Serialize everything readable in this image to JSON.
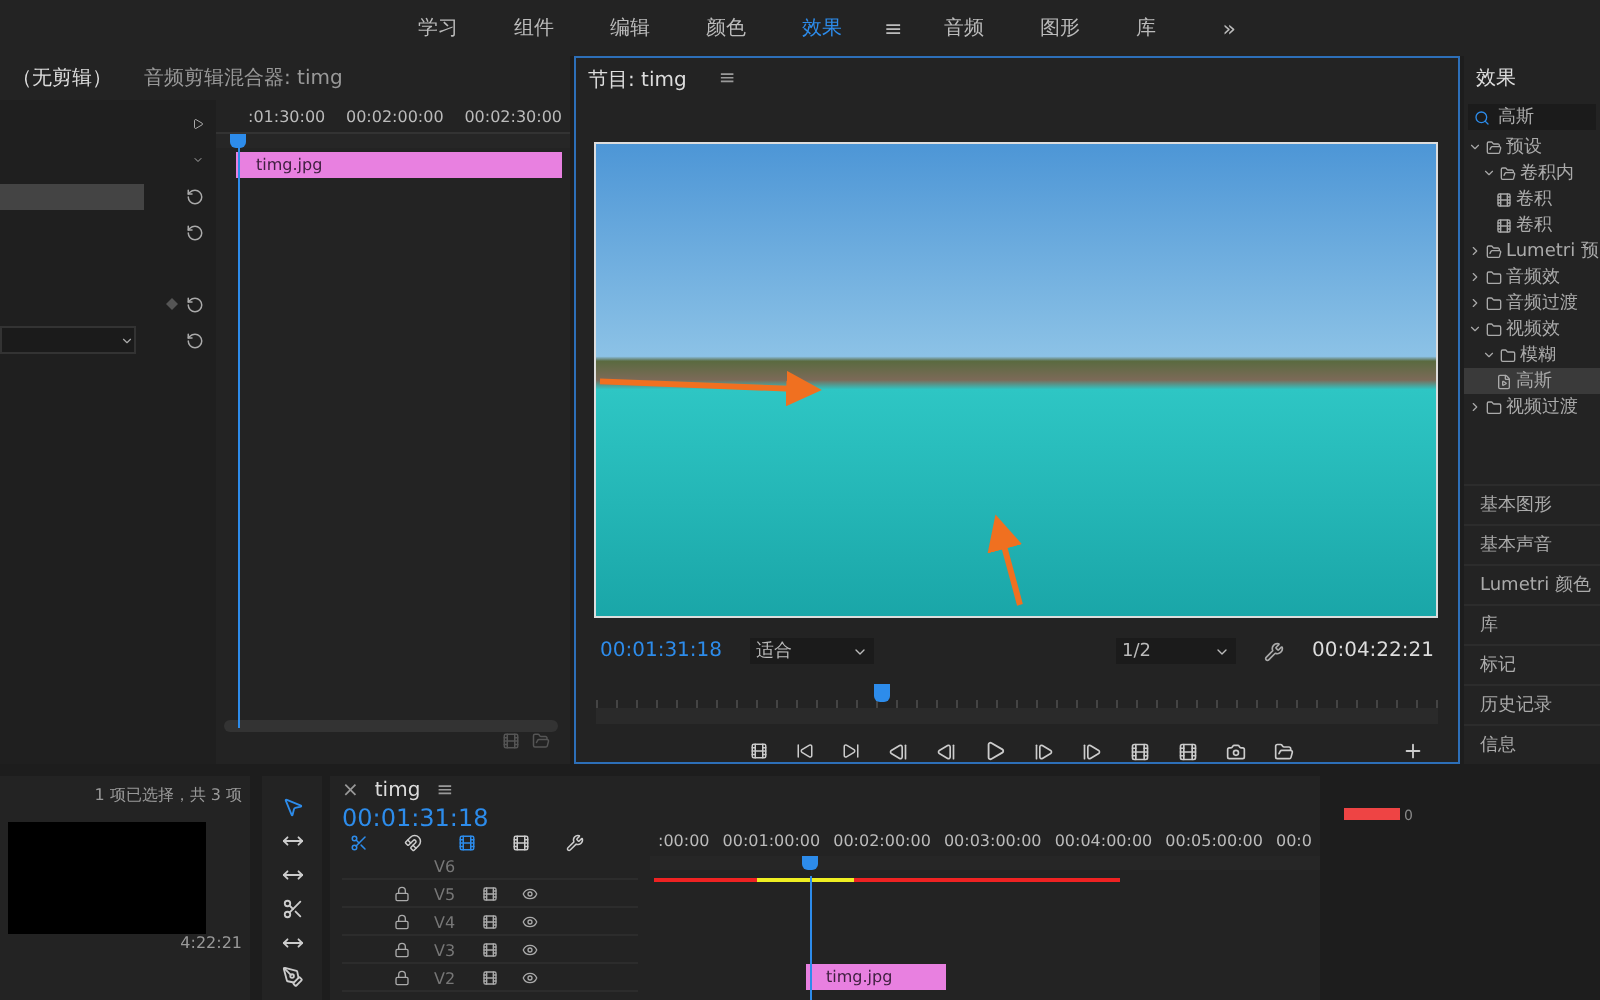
{
  "workspace_tabs": [
    {
      "label": "学习",
      "selected": false
    },
    {
      "label": "组件",
      "selected": false
    },
    {
      "label": "编辑",
      "selected": false
    },
    {
      "label": "颜色",
      "selected": false
    },
    {
      "label": "效果",
      "selected": true
    },
    {
      "label": "音频",
      "selected": false
    },
    {
      "label": "图形",
      "selected": false
    },
    {
      "label": "库",
      "selected": false
    }
  ],
  "workspace_menu": "≡",
  "more": "»",
  "source_panel": {
    "tabs": [
      "（无剪辑）",
      "音频剪辑混合器: timg"
    ],
    "ruler": [
      ":01:30:00",
      "00:02:00:00",
      "00:02:30:00"
    ],
    "clip": "timg.jpg",
    "playhead": {
      "level": 0.06
    }
  },
  "program": {
    "title": "节目: timg",
    "menu": "≡",
    "timecode": "00:01:31:18",
    "zoom": "适合",
    "resolution": "1/2",
    "duration": "00:04:22:21",
    "playhead": {
      "level": 0.34
    }
  },
  "effects": {
    "title": "效果",
    "search": "高斯",
    "tree": [
      {
        "label": "预设",
        "kind": "bin",
        "expanded": true,
        "selected": false,
        "children": [
          {
            "label": "卷积内",
            "kind": "bin",
            "expanded": true,
            "selected": false,
            "children": [
              {
                "label": "卷积",
                "kind": "preset",
                "selected": false
              },
              {
                "label": "卷积",
                "kind": "preset",
                "selected": false
              }
            ]
          }
        ]
      },
      {
        "label": "Lumetri 预",
        "kind": "bin",
        "expanded": false,
        "selected": false
      },
      {
        "label": "音频效",
        "kind": "folder",
        "expanded": false,
        "selected": false
      },
      {
        "label": "音频过渡",
        "kind": "folder",
        "expanded": false,
        "selected": false
      },
      {
        "label": "视频效",
        "kind": "folder",
        "expanded": true,
        "selected": false,
        "children": [
          {
            "label": "模糊",
            "kind": "folder",
            "expanded": true,
            "selected": false,
            "children": [
              {
                "label": "高斯",
                "kind": "effect",
                "selected": true
              }
            ]
          }
        ]
      },
      {
        "label": "视频过渡",
        "kind": "folder",
        "expanded": false,
        "selected": false
      }
    ],
    "panels": [
      "基本图形",
      "基本声音",
      "Lumetri 颜色",
      "库",
      "标记",
      "历史记录",
      "信息"
    ]
  },
  "project": {
    "status": "1 项已选择，共 3 项",
    "duration": "4:22:21"
  },
  "timeline": {
    "close": "×",
    "title": "timg",
    "menu": "≡",
    "timecode": "00:01:31:18",
    "ruler": [
      ":00:00",
      "00:01:00:00",
      "00:02:00:00",
      "00:03:00:00",
      "00:04:00:00",
      "00:05:00:00",
      "00:0"
    ],
    "tracks": [
      "V6",
      "V5",
      "V4",
      "V3",
      "V2"
    ],
    "clip": "timg.jpg",
    "playhead": {
      "level": 0.24
    }
  },
  "meter": {
    "reading": "0"
  }
}
